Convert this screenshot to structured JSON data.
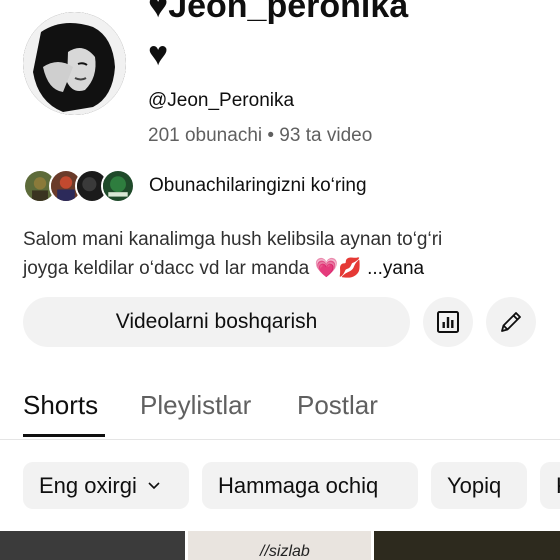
{
  "channel": {
    "name": "♥Jeon_peronika",
    "heart": "♥",
    "handle": "@Jeon_Peronika",
    "stats": "201 obunachi • 93 ta video"
  },
  "subscribers": {
    "label": "Obunachilaringizni ko‘ring"
  },
  "description": {
    "line1": "Salom mani kanalimga hush kelibsila aynan to‘g‘ri",
    "line2": "joyga keldilar o‘dacc vd lar manda 💗💋 ",
    "more": "...yana"
  },
  "actions": {
    "manage_label": "Videolarni boshqarish"
  },
  "tabs": [
    "Shorts",
    "Pleylistlar",
    "Postlar"
  ],
  "active_tab": "Shorts",
  "filters": {
    "sort_label": "Eng oxirgi",
    "chips": [
      "Hammaga ochiq",
      "Yopiq",
      "K"
    ]
  },
  "thumbnail_text": "//sizlab"
}
